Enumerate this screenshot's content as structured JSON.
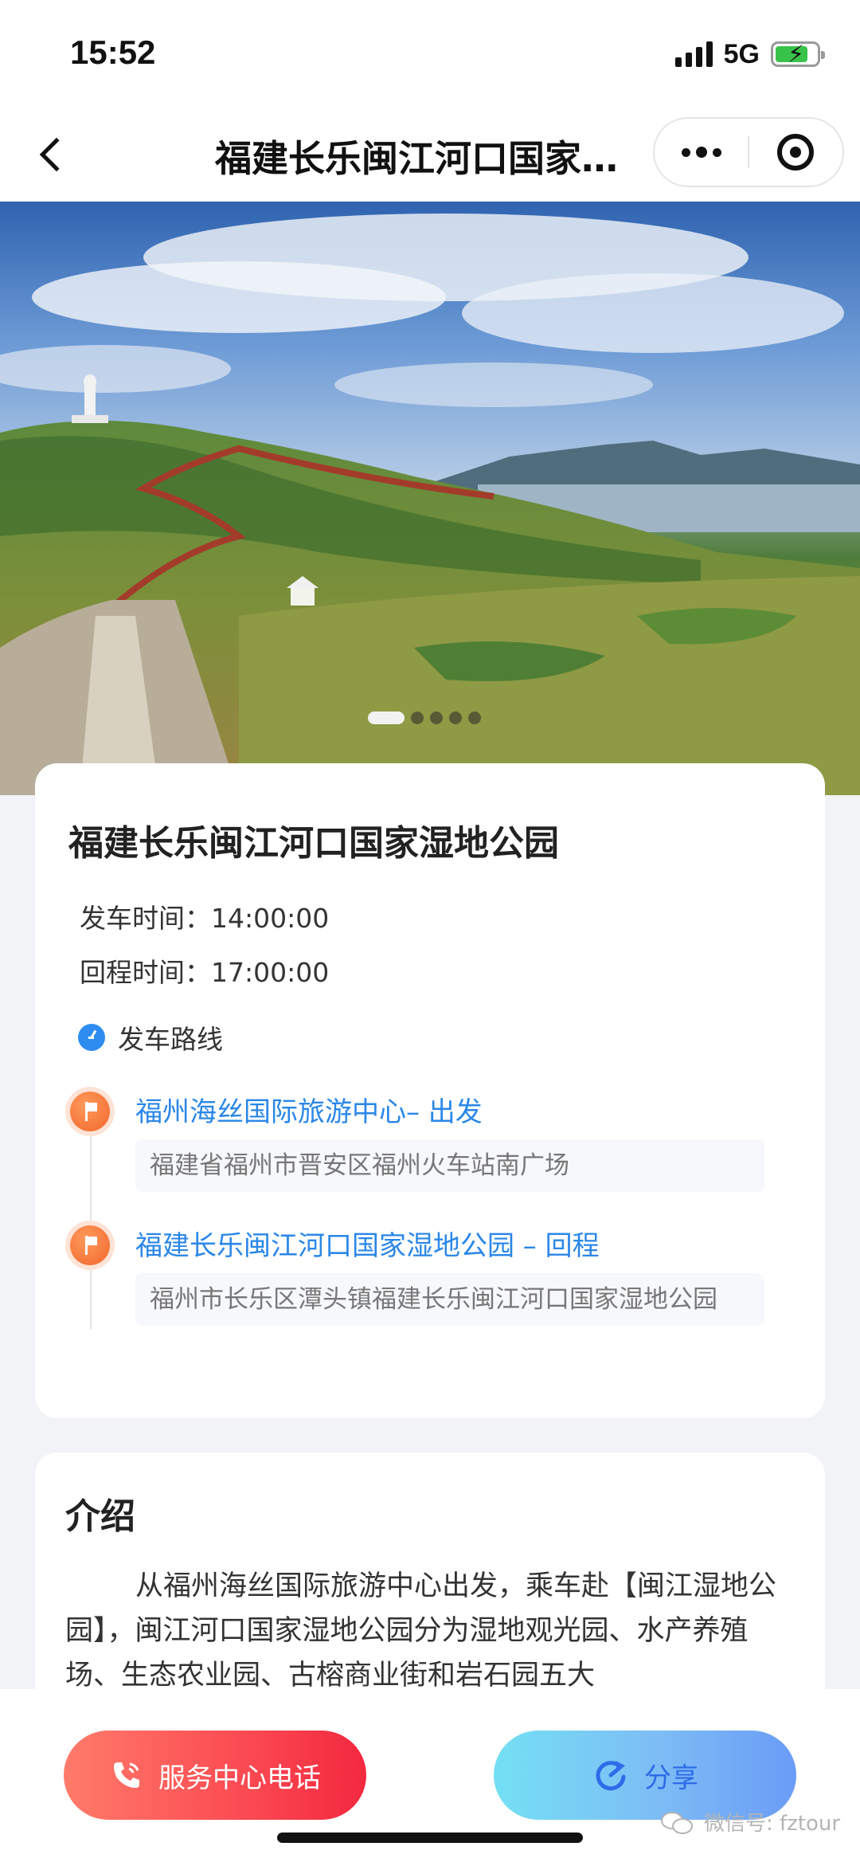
{
  "status_bar": {
    "time": "15:52",
    "network": "5G",
    "battery_level": 0.8,
    "battery_color": "#39c24a"
  },
  "nav": {
    "back_icon": "chevron-left-icon",
    "title": "福建长乐闽江河口国家湿地公园",
    "more_icon": "more-dots-icon",
    "close_icon": "target-ring-icon"
  },
  "hero": {
    "image_alt": "",
    "carousel_count": 5,
    "carousel_active_index": 0
  },
  "info": {
    "title": "福建长乐闽江河口国家湿地公园",
    "depart_time_label": "发车时间：",
    "depart_time": "14:00:00",
    "return_time_label": "回程时间：",
    "return_time": "17:00:00",
    "route_label": "发车路线",
    "route_icon": "clock-icon",
    "stops": [
      {
        "icon": "flag-icon",
        "name": "福州海丝国际旅游中心– 出发",
        "address": "福建省福州市晋安区福州火车站南广场"
      },
      {
        "icon": "flag-icon",
        "name": "福建长乐闽江河口国家湿地公园 – 回程",
        "address": "福州市长乐区潭头镇福建长乐闽江河口国家湿地公园"
      }
    ]
  },
  "intro": {
    "title": "介绍",
    "text": "从福州海丝国际旅游中心出发，乘车赴【闽江湿地公园】，闽江河口国家湿地公园分为湿地观光园、水产养殖场、生态农业园、古榕商业街和岩石园五大"
  },
  "bottom": {
    "phone_button": "服务中心电话",
    "phone_icon": "phone-icon",
    "share_button": "分享",
    "share_icon": "share-icon",
    "watermark": "微信号: fztour",
    "watermark_icon": "wechat-icon"
  },
  "colors": {
    "link_blue": "#2a87e8",
    "flag_orange": "#f2662b",
    "phone_gradient_end": "#f3283f",
    "share_gradient_end": "#6a9cf6"
  }
}
